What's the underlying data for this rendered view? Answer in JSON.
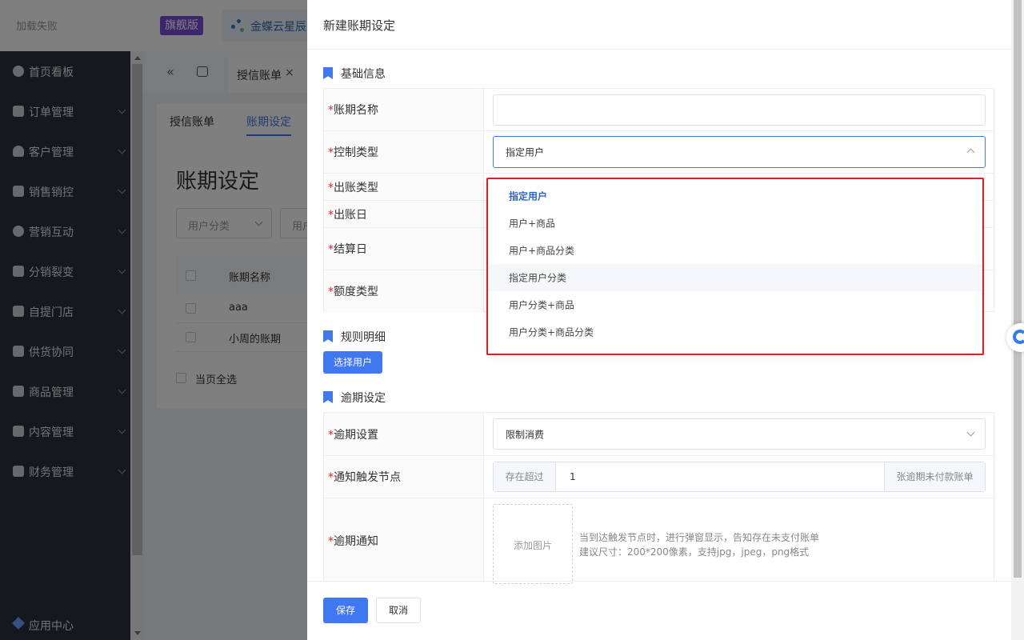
{
  "topbar": {
    "load_fail": "加载失败",
    "edition_badge": "旗舰版",
    "brand_name": "金蝶云星辰"
  },
  "sidebar": {
    "items": [
      {
        "label": "首页看板",
        "icon": "dashboard-icon"
      },
      {
        "label": "订单管理",
        "icon": "order-icon"
      },
      {
        "label": "客户管理",
        "icon": "customer-icon"
      },
      {
        "label": "销售销控",
        "icon": "tag-icon"
      },
      {
        "label": "营销互动",
        "icon": "marketing-icon"
      },
      {
        "label": "分销裂变",
        "icon": "distribution-icon"
      },
      {
        "label": "自提门店",
        "icon": "store-icon"
      },
      {
        "label": "供货协同",
        "icon": "supply-icon"
      },
      {
        "label": "商品管理",
        "icon": "goods-icon"
      },
      {
        "label": "内容管理",
        "icon": "content-icon"
      },
      {
        "label": "财务管理",
        "icon": "finance-icon"
      }
    ],
    "app_center": "应用中心"
  },
  "nav_tabs": {
    "active_tab": "授信账单",
    "close_glyph": "×",
    "collapse_glyph": "«"
  },
  "content": {
    "sub_tabs": [
      "授信账单",
      "账期设定"
    ],
    "heading": "账期设定",
    "filter_placeholder": "用户分类",
    "filter2_placeholder": "用户",
    "table_header": "账期名称",
    "rows": [
      "aaa",
      "小周的账期"
    ],
    "select_all": "当页全选"
  },
  "drawer": {
    "title": "新建账期设定",
    "basic_section": "基础信息",
    "fields": {
      "name_label": "账期名称",
      "control_type_label": "控制类型",
      "control_type_value": "指定用户",
      "bill_type_label": "出账类型",
      "bill_day_label": "出账日",
      "settle_day_label": "结算日",
      "quota_type_label": "额度类型"
    },
    "rule_section": "规则明细",
    "select_user_button": "选择用户",
    "overdue_section": "逾期设定",
    "overdue_fields": {
      "setting_label": "逾期设置",
      "setting_value": "限制消费",
      "trigger_label": "通知触发节点",
      "trigger_prefix": "存在超过",
      "trigger_value": "1",
      "trigger_suffix": "张逾期未付款账单",
      "notice_label": "逾期通知",
      "upload_label": "添加图片",
      "hint_line1": "当到达触发节点时，进行弹窗显示，告知存在未支付账单",
      "hint_line2": "建议尺寸：200*200像素，支持jpg，jpeg，png格式"
    },
    "save_button": "保存",
    "cancel_button": "取消"
  },
  "dropdown": {
    "options": [
      "指定用户",
      "用户+商品",
      "用户+商品分类",
      "指定用户分类",
      "用户分类+商品",
      "用户分类+商品分类"
    ],
    "selected": "指定用户",
    "hovered": "指定用户分类"
  },
  "colors": {
    "primary": "#4078f2",
    "required": "#f5222d",
    "highlight_box": "#e02020",
    "sidebar_bg": "#2d3140"
  }
}
